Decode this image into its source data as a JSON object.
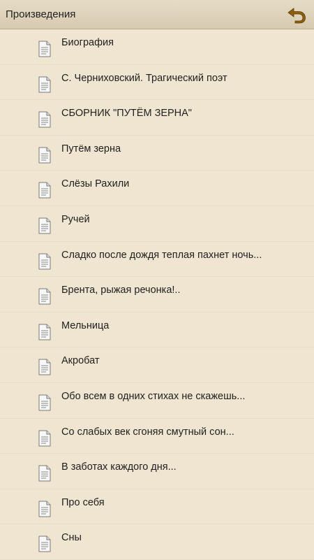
{
  "header": {
    "title": "Произведения",
    "back_icon": "back-arrow-icon"
  },
  "list": {
    "item_icon": "document-icon",
    "items": [
      {
        "label": "Биография"
      },
      {
        "label": "С. Черниховский. Трагический поэт"
      },
      {
        "label": "СБОРНИК \"ПУТЁМ ЗЕРНА\""
      },
      {
        "label": "Путём зерна"
      },
      {
        "label": "Слёзы Рахили"
      },
      {
        "label": "Ручей"
      },
      {
        "label": "Сладко после дождя теплая пахнет ночь..."
      },
      {
        "label": "Брента, рыжая речонка!.."
      },
      {
        "label": "Мельница"
      },
      {
        "label": "Акробат"
      },
      {
        "label": "Обо всем в одних стихах не скажешь..."
      },
      {
        "label": "Со слабых век сгоняя смутный сон..."
      },
      {
        "label": "В заботах каждого дня..."
      },
      {
        "label": "Про себя"
      },
      {
        "label": "Сны"
      }
    ]
  },
  "colors": {
    "background": "#efe5d0",
    "header": "#ddd2ba",
    "accent": "#9a6a10"
  }
}
